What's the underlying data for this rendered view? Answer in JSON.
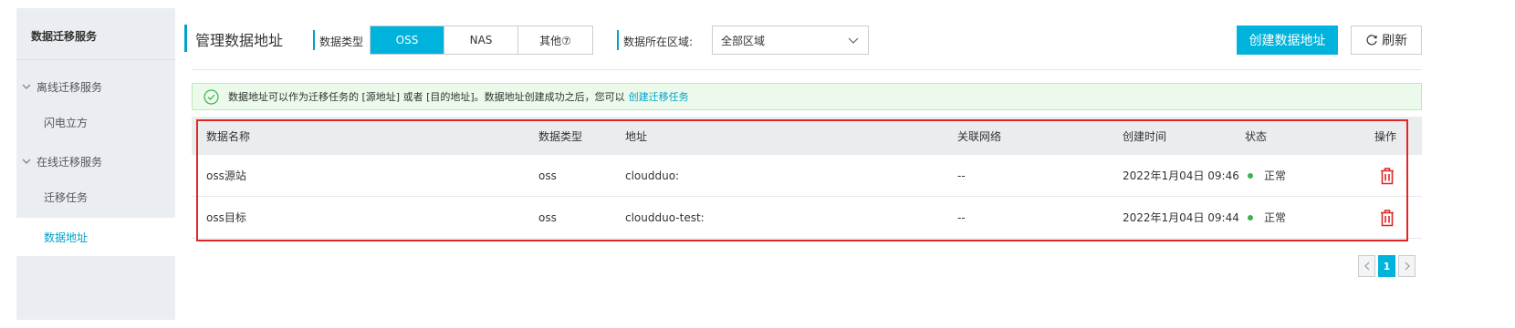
{
  "sidebar": {
    "title": "数据迁移服务",
    "groups": [
      {
        "label": "离线迁移服务",
        "items": [
          {
            "label": "闪电立方"
          }
        ]
      },
      {
        "label": "在线迁移服务",
        "items": [
          {
            "label": "迁移任务"
          },
          {
            "label": "数据地址"
          }
        ]
      }
    ]
  },
  "header": {
    "title": "管理数据地址",
    "type_label": "数据类型",
    "type_options": [
      "OSS",
      "NAS",
      "其他⑦"
    ],
    "type_selected": "OSS",
    "region_label": "数据所在区域:",
    "region_value": "全部区域",
    "create_label": "创建数据地址",
    "refresh_label": "刷新"
  },
  "alert": {
    "text": "数据地址可以作为迁移任务的 [源地址] 或者 [目的地址]。数据地址创建成功之后，您可以",
    "link": "创建迁移任务"
  },
  "table": {
    "columns": [
      "数据名称",
      "数据类型",
      "地址",
      "关联网络",
      "创建时间",
      "状态",
      "操作"
    ],
    "rows": [
      {
        "name": "oss源站",
        "type": "oss",
        "address": "cloudduo:",
        "network": "--",
        "created": "2022年1月04日 09:46",
        "status": "正常"
      },
      {
        "name": "oss目标",
        "type": "oss",
        "address": "cloudduo-test:",
        "network": "--",
        "created": "2022年1月04日 09:44",
        "status": "正常"
      }
    ]
  },
  "pager": {
    "current": "1"
  },
  "colors": {
    "accent": "#00b3dc",
    "status_ok": "#3cb34a",
    "delete": "#e02727",
    "highlight": "#e02727"
  }
}
